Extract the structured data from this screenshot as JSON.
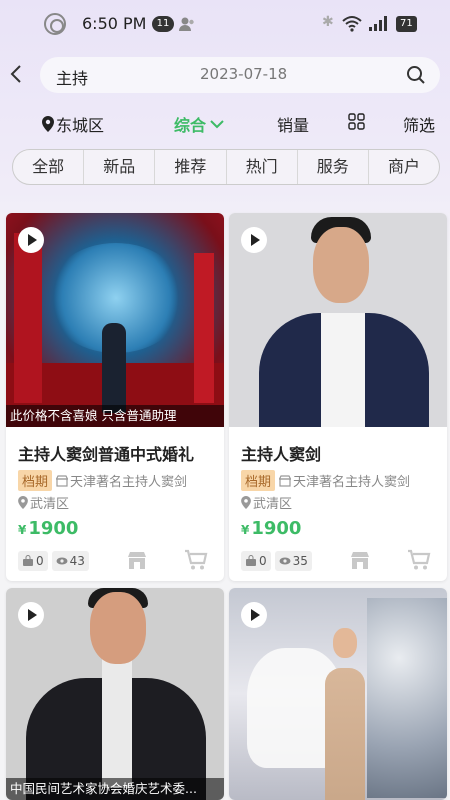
{
  "status_bar": {
    "time": "6:50 PM",
    "notification_count": "11",
    "battery": "71"
  },
  "search": {
    "keyword": "主持",
    "date": "2023-07-18"
  },
  "filters": {
    "location": "东城区",
    "sort_default": "综合",
    "sort_sales": "销量",
    "filter": "筛选"
  },
  "tabs": [
    "全部",
    "新品",
    "推荐",
    "热门",
    "服务",
    "商户"
  ],
  "colors": {
    "accent_green": "#3dbb66",
    "tag_bg": "#f8d6a8",
    "tag_text": "#a8692a"
  },
  "cards": [
    {
      "caption": "此价格不含喜娘 只含普通助理",
      "title": "主持人窦剑普通中式婚礼",
      "schedule_tag": "档期",
      "merchant": "天津著名主持人窦剑",
      "district": "武清区",
      "currency": "¥",
      "price": "1900",
      "favorites": "0",
      "views": "43"
    },
    {
      "caption": "",
      "title": "主持人窦剑",
      "schedule_tag": "档期",
      "merchant": "天津著名主持人窦剑",
      "district": "武清区",
      "currency": "¥",
      "price": "1900",
      "favorites": "0",
      "views": "35"
    },
    {
      "caption": "中国民间艺术家协会婚庆艺术委..."
    },
    {
      "caption": ""
    }
  ]
}
